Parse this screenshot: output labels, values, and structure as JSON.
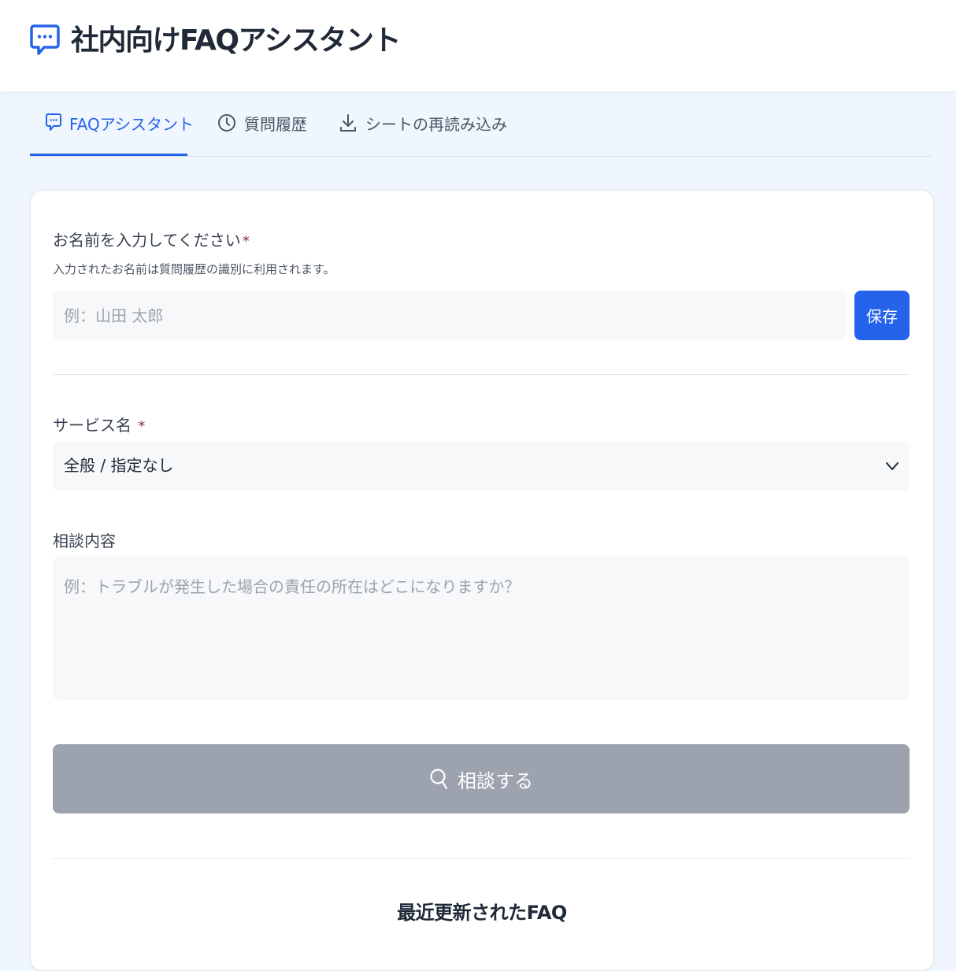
{
  "header": {
    "title": "社内向けFAQアシスタント"
  },
  "tabs": [
    {
      "label": "FAQアシスタント",
      "icon": "chat-bubble-icon",
      "active": true
    },
    {
      "label": "質問履歴",
      "icon": "clock-icon",
      "active": false
    },
    {
      "label": "シートの再読み込み",
      "icon": "download-icon",
      "active": false
    }
  ],
  "form": {
    "name_label": "お名前を入力してください",
    "name_required": "*",
    "name_hint": "入力されたお名前は質問履歴の識別に利用されます。",
    "name_placeholder": "例：山田 太郎",
    "save_label": "保存",
    "service_label": "サービス名",
    "service_required": "*",
    "service_selected": "全般 / 指定なし",
    "consult_label": "相談内容",
    "consult_placeholder": "例：トラブルが発生した場合の責任の所在はどこになりますか？",
    "submit_label": "相談する"
  },
  "recent": {
    "title": "最近更新されたFAQ"
  },
  "colors": {
    "accent": "#2563eb",
    "disabled_button": "#9ca3af",
    "required_mark": "#8b2b4b",
    "page_bg": "#f0f6fd"
  }
}
